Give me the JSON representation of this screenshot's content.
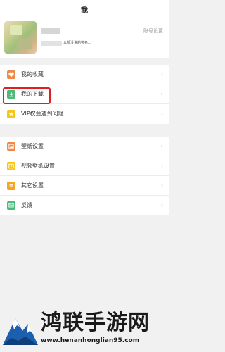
{
  "header": {
    "title": "我"
  },
  "profile": {
    "signature": "么都没说的签名...",
    "account_settings": "账号设置"
  },
  "menu_group_1": [
    {
      "label": "我的收藏",
      "icon": "heart-icon",
      "color": "#f08a4b"
    },
    {
      "label": "我的下载",
      "icon": "download-icon",
      "color": "#4cbb7a"
    },
    {
      "label": "VIP权益遇到问题",
      "icon": "star-icon",
      "color": "#f5c518"
    }
  ],
  "menu_group_2": [
    {
      "label": "壁纸设置",
      "icon": "wallpaper-icon",
      "color": "#f08a4b"
    },
    {
      "label": "视频壁纸设置",
      "icon": "video-wallpaper-icon",
      "color": "#f5c518"
    },
    {
      "label": "其它设置",
      "icon": "settings-icon",
      "color": "#f5a623"
    },
    {
      "label": "反馈",
      "icon": "feedback-icon",
      "color": "#4cbb7a"
    }
  ],
  "chevron": "›",
  "watermark": {
    "title": "鸿联手游网",
    "url": "www.henanhonglian95.com"
  }
}
